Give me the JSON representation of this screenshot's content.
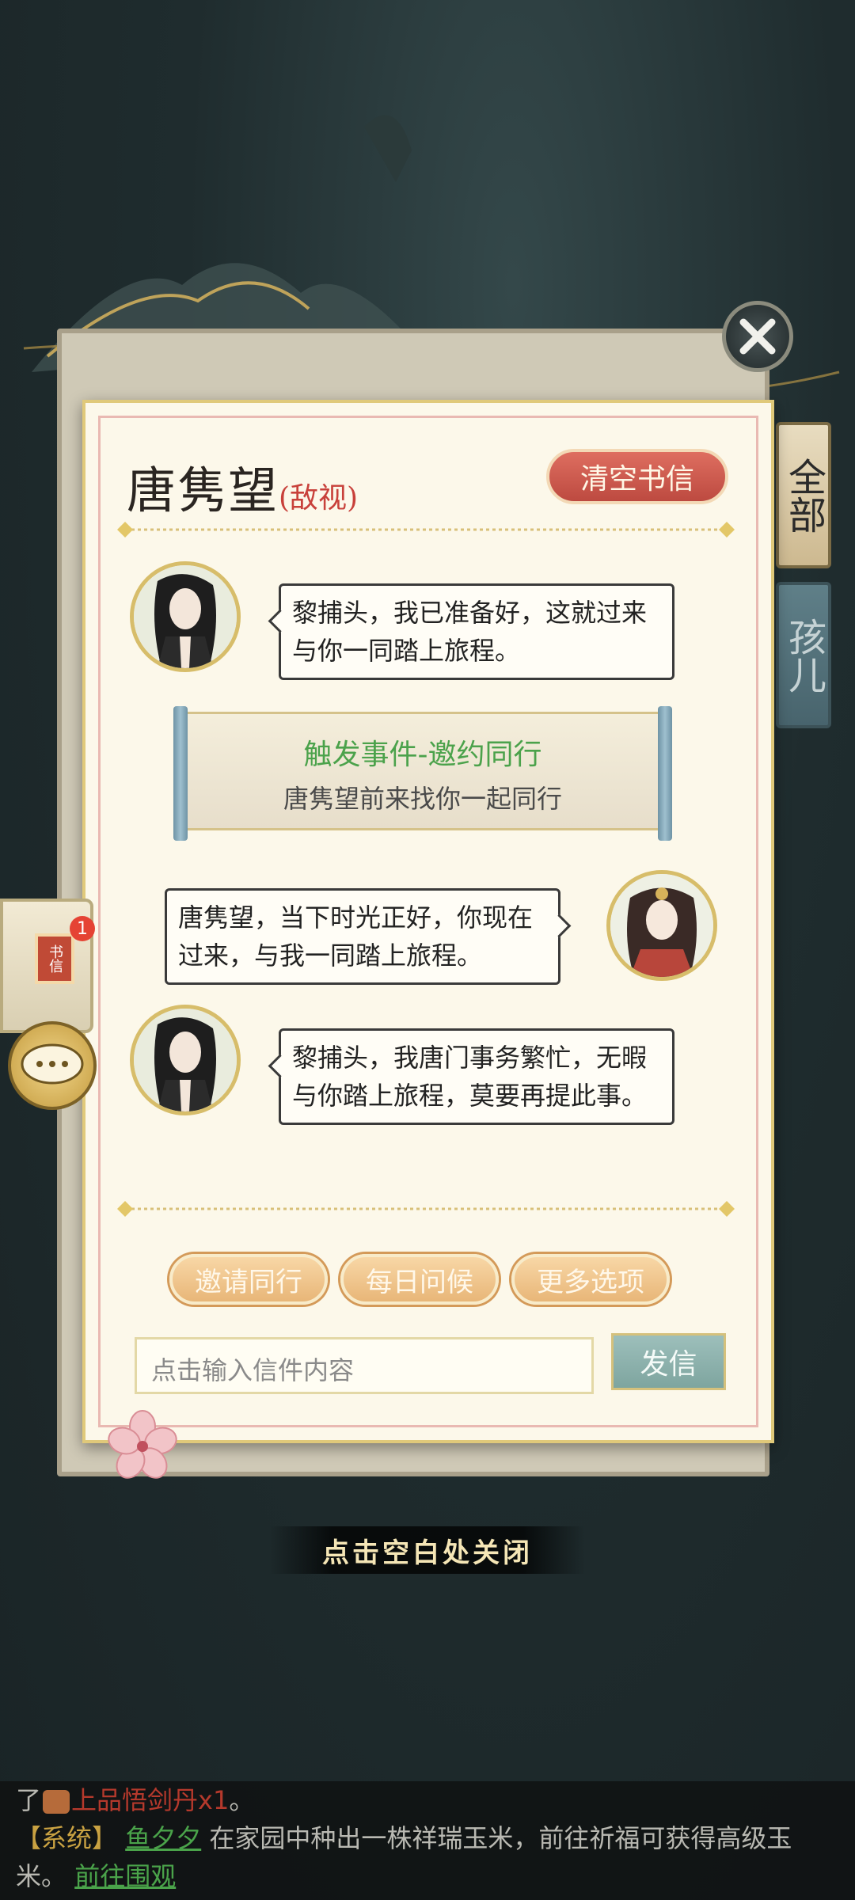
{
  "panel": {
    "title": "唐隽望",
    "relation": "(敌视)",
    "clear_label": "清空书信"
  },
  "side_tabs": [
    "全部",
    "孩儿"
  ],
  "messages": [
    {
      "side": "left",
      "text": "黎捕头，我已准备好，这就过来与你一同踏上旅程。"
    },
    {
      "side": "right",
      "text": "唐隽望，当下时光正好，你现在过来，与我一同踏上旅程。"
    },
    {
      "side": "left",
      "text": "黎捕头，我唐门事务繁忙，无暇与你踏上旅程，莫要再提此事。"
    }
  ],
  "event": {
    "title": "触发事件-邀约同行",
    "desc": "唐隽望前来找你一起同行"
  },
  "options": [
    "邀请同行",
    "每日问候",
    "更多选项"
  ],
  "input": {
    "placeholder": "点击输入信件内容"
  },
  "send_label": "发信",
  "letter_widget": {
    "label": "书信",
    "badge": "1"
  },
  "close_hint": "点击空白处关闭",
  "chat_log": {
    "line1_prefix": "了",
    "line1_item": "上品悟剑丹x1",
    "line1_suffix": "。",
    "line2_tag": "【系统】",
    "line2_player": "鱼夕夕",
    "line2_text": "在家园中种出一株祥瑞玉米，前往祈福可获得高级玉",
    "line3_text": "米。",
    "line3_link": "前往围观"
  },
  "colors": {
    "accent_red": "#c8413b",
    "event_green": "#4ba24b",
    "panel_bg": "#fcf8ea"
  }
}
